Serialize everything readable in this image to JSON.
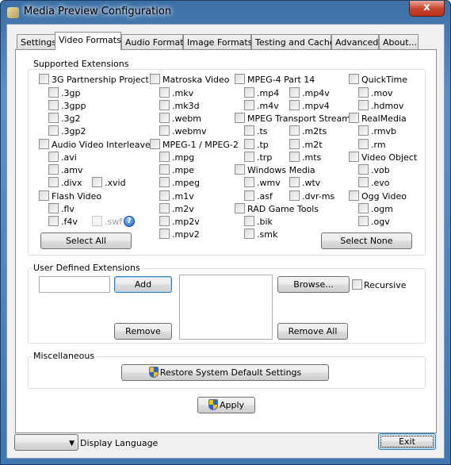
{
  "window": {
    "title": "Media Preview Configuration",
    "close_label": "x"
  },
  "tabs": [
    {
      "label": "Settings"
    },
    {
      "label": "Video Formats",
      "selected": true
    },
    {
      "label": "Audio Formats"
    },
    {
      "label": "Image Formats"
    },
    {
      "label": "Testing and Cache"
    },
    {
      "label": "Advanced"
    },
    {
      "label": "About..."
    }
  ],
  "supported": {
    "title": "Supported Extensions",
    "checkboxes": [
      {
        "label": "3G Partnership Project",
        "checked": false
      },
      {
        "label": ".3gp",
        "checked": false
      },
      {
        "label": ".3gpp",
        "checked": false
      },
      {
        "label": ".3g2",
        "checked": false
      },
      {
        "label": ".3gp2",
        "checked": false
      },
      {
        "label": "Audio Video Interleaved",
        "checked": false
      },
      {
        "label": ".avi",
        "checked": false
      },
      {
        "label": ".amv",
        "checked": false
      },
      {
        "label": ".divx",
        "checked": false
      },
      {
        "label": ".xvid",
        "checked": false
      },
      {
        "label": "Flash Video",
        "checked": false
      },
      {
        "label": ".flv",
        "checked": false
      },
      {
        "label": ".f4v",
        "checked": false
      },
      {
        "label": ".swf",
        "checked": false,
        "disabled": true
      },
      {
        "label": "Matroska Video",
        "checked": false
      },
      {
        "label": ".mkv",
        "checked": false
      },
      {
        "label": ".mk3d",
        "checked": false
      },
      {
        "label": ".webm",
        "checked": false
      },
      {
        "label": ".webmv",
        "checked": false
      },
      {
        "label": "MPEG-1 / MPEG-2",
        "checked": false
      },
      {
        "label": ".mpg",
        "checked": false
      },
      {
        "label": ".mpe",
        "checked": false
      },
      {
        "label": ".mpeg",
        "checked": false
      },
      {
        "label": ".m1v",
        "checked": false
      },
      {
        "label": ".m2v",
        "checked": false
      },
      {
        "label": ".mp2v",
        "checked": false
      },
      {
        "label": ".mpv2",
        "checked": false
      },
      {
        "label": "MPEG-4 Part 14",
        "checked": false
      },
      {
        "label": ".mp4",
        "checked": false
      },
      {
        "label": ".mp4v",
        "checked": false
      },
      {
        "label": ".m4v",
        "checked": false
      },
      {
        "label": ".mpv4",
        "checked": false
      },
      {
        "label": "MPEG Transport Stream",
        "checked": false
      },
      {
        "label": ".ts",
        "checked": false
      },
      {
        "label": ".m2ts",
        "checked": false
      },
      {
        "label": ".tp",
        "checked": false
      },
      {
        "label": ".m2t",
        "checked": false
      },
      {
        "label": ".trp",
        "checked": false
      },
      {
        "label": ".mts",
        "checked": false
      },
      {
        "label": "Windows Media",
        "checked": false
      },
      {
        "label": ".wmv",
        "checked": false
      },
      {
        "label": ".wtv",
        "checked": false
      },
      {
        "label": ".asf",
        "checked": false
      },
      {
        "label": ".dvr-ms",
        "checked": false
      },
      {
        "label": "RAD Game Tools",
        "checked": false
      },
      {
        "label": ".bik",
        "checked": false
      },
      {
        "label": ".smk",
        "checked": false
      },
      {
        "label": "QuickTime",
        "checked": false
      },
      {
        "label": ".mov",
        "checked": false
      },
      {
        "label": ".hdmov",
        "checked": false
      },
      {
        "label": "RealMedia",
        "checked": false
      },
      {
        "label": ".rmvb",
        "checked": false
      },
      {
        "label": ".rm",
        "checked": false
      },
      {
        "label": "Video Object",
        "checked": false
      },
      {
        "label": ".vob",
        "checked": false
      },
      {
        "label": ".evo",
        "checked": false
      },
      {
        "label": "Ogg Video",
        "checked": false
      },
      {
        "label": ".ogm",
        "checked": false
      },
      {
        "label": ".ogv",
        "checked": false
      }
    ],
    "help_icon": "question-circle-icon",
    "select_all": "Select All",
    "select_none": "Select None"
  },
  "user_defined": {
    "title": "User Defined Extensions",
    "input_value": "",
    "add": "Add",
    "remove": "Remove",
    "browse": "Browse...",
    "recursive": "Recursive",
    "recursive_checked": false,
    "remove_all": "Remove All"
  },
  "misc": {
    "title": "Miscellaneous",
    "restore": "Restore System Default Settings"
  },
  "apply": "Apply",
  "footer": {
    "language_value": "",
    "language_label": "Display Language",
    "exit": "Exit"
  }
}
